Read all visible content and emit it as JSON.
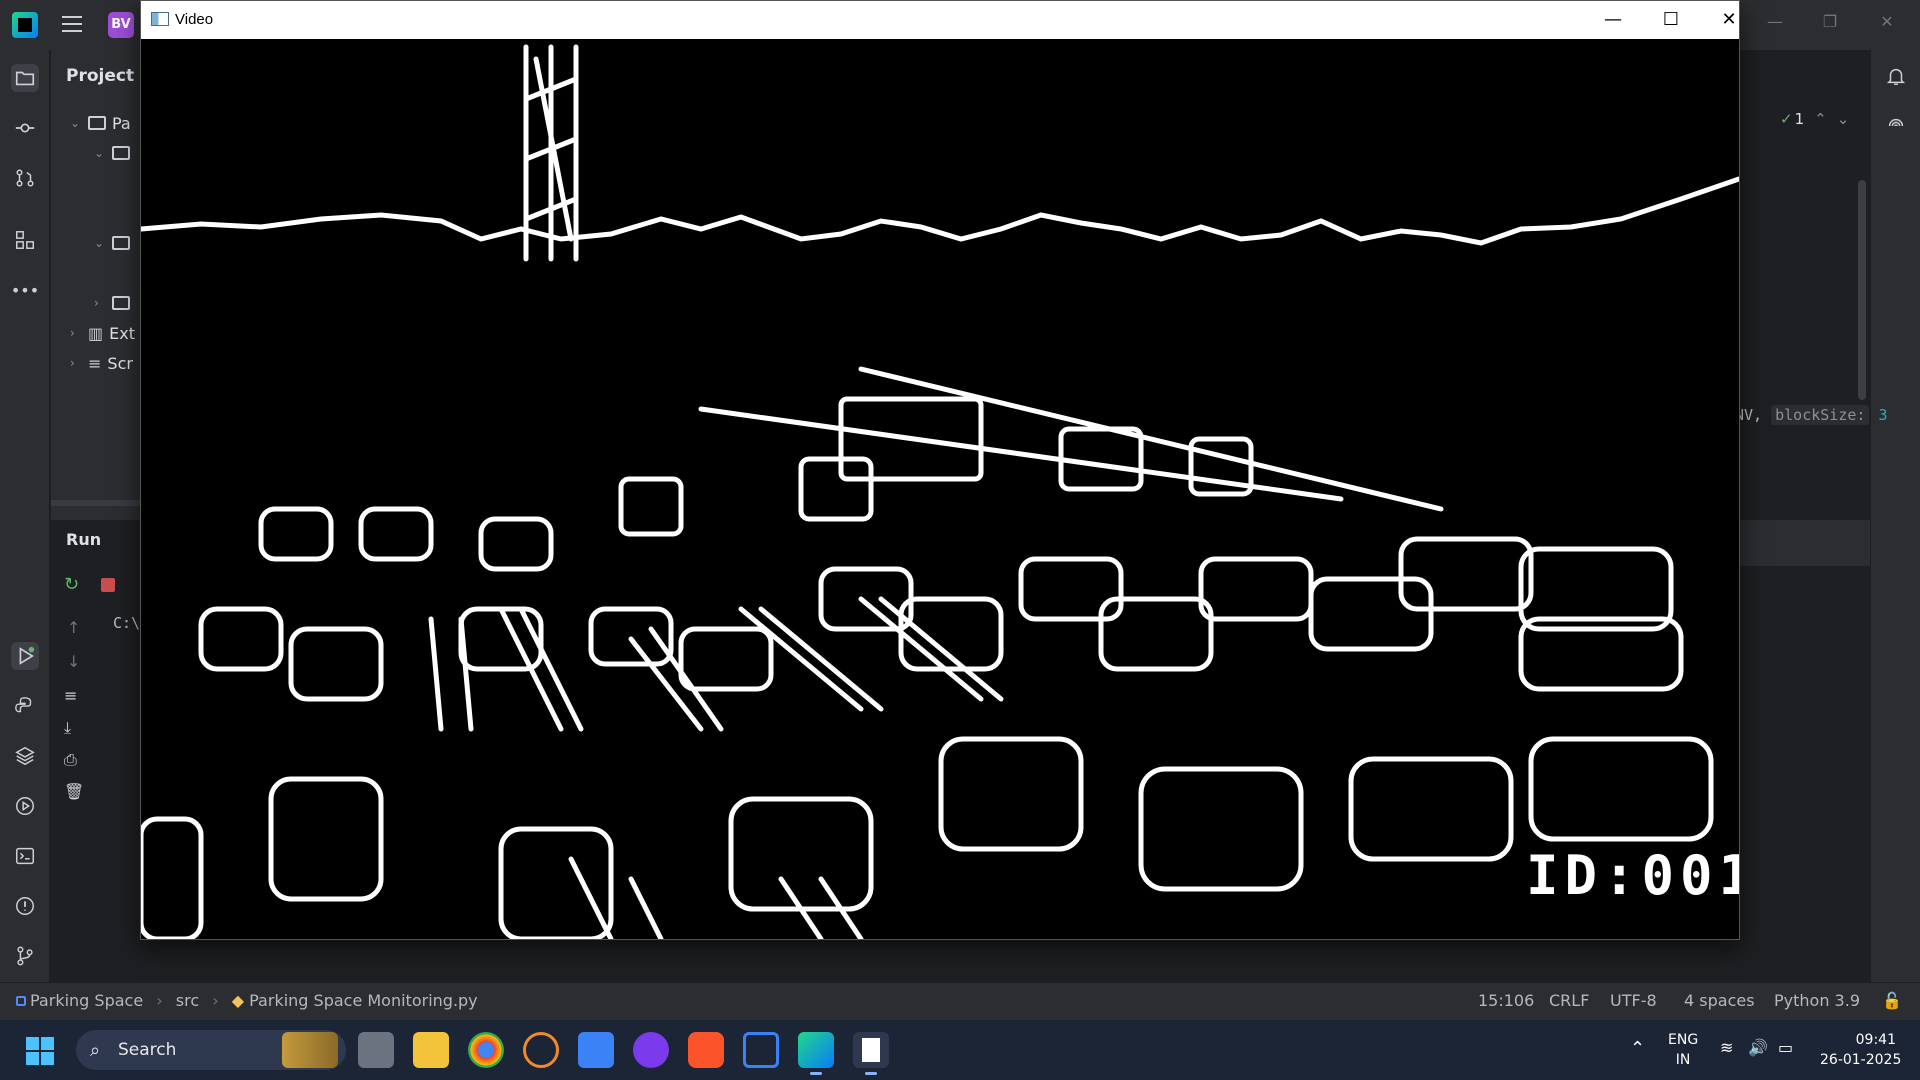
{
  "ide": {
    "project_badge": "BV",
    "project_panel": {
      "title": "Project",
      "tree": [
        {
          "label": "Pa",
          "expanded": true
        },
        {
          "label": "",
          "expanded": true
        },
        {
          "label": "",
          "expanded": true
        },
        {
          "label": "",
          "expanded": false
        },
        {
          "label": "Ext",
          "expanded": false
        },
        {
          "label": "Scr",
          "expanded": false
        }
      ]
    },
    "run_panel": {
      "title": "Run",
      "console_text": "C:\\"
    },
    "editor": {
      "inline_text": "NV,",
      "param_hint": "blockSize:",
      "param_value": "3",
      "check_count": "1"
    },
    "statusbar": {
      "breadcrumb": [
        "Parking Space",
        "src",
        "Parking Space Monitoring.py"
      ],
      "cursor": "15:106",
      "line_sep": "CRLF",
      "encoding": "UTF-8",
      "indent": "4 spaces",
      "interpreter": "Python 3.9"
    }
  },
  "video_window": {
    "title": "Video",
    "overlay_text": "ID:001"
  },
  "taskbar": {
    "search_label": "Search",
    "language_line1": "ENG",
    "language_line2": "IN",
    "time": "09:41",
    "date": "26-01-2025"
  }
}
